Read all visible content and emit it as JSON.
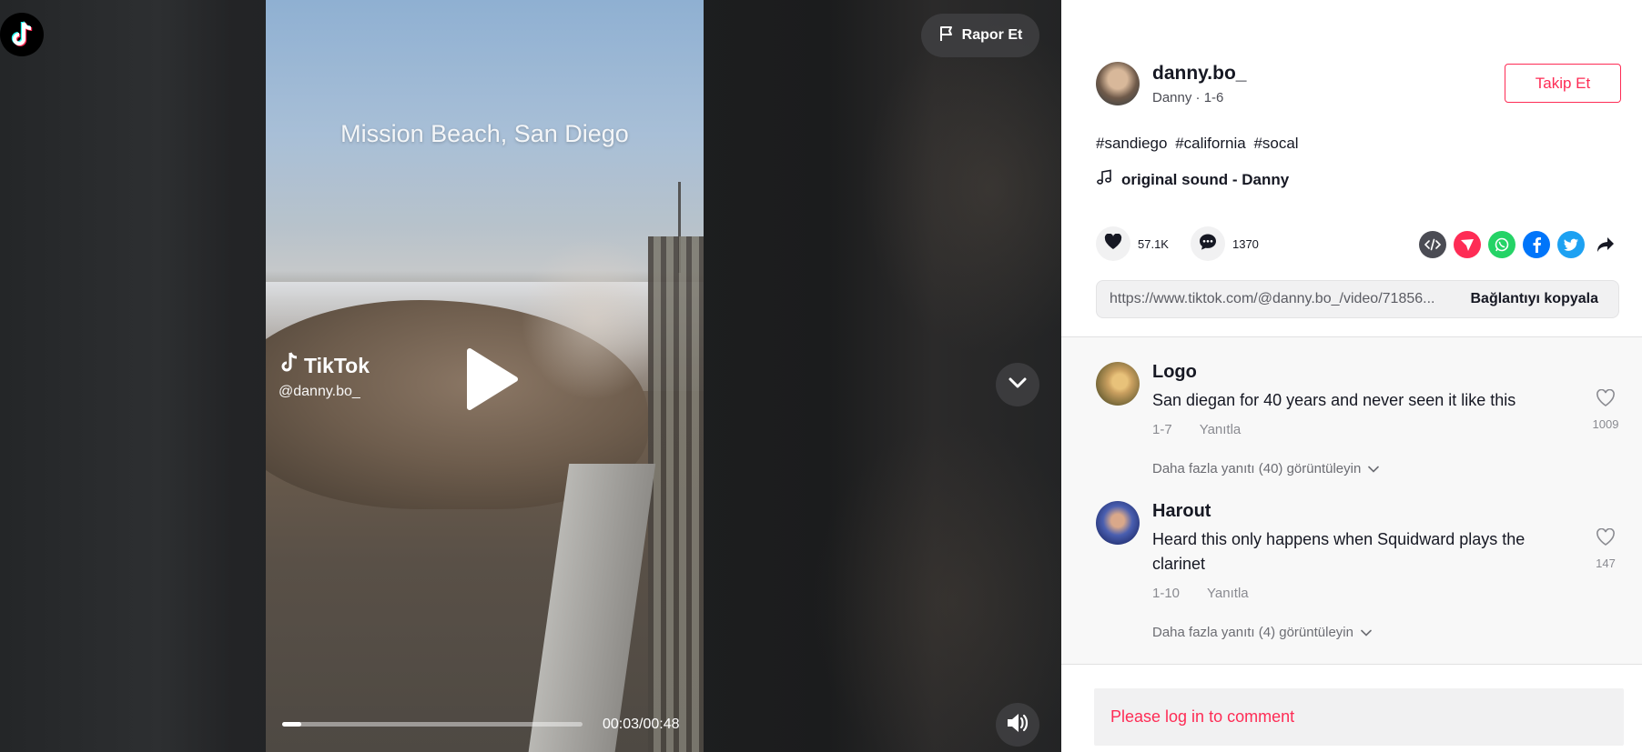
{
  "video": {
    "caption_overlay": "Mission Beach, San Diego",
    "watermark_brand": "TikTok",
    "watermark_user": "@danny.bo_",
    "time_display": "00:03/00:48",
    "progress": 0.0625,
    "report_label": "Rapor Et"
  },
  "author": {
    "username": "danny.bo_",
    "subtitle": "Danny · 1-6",
    "follow_label": "Takip Et"
  },
  "post": {
    "hashtags": [
      "#sandiego",
      "#california",
      "#socal"
    ],
    "sound": "original sound - Danny",
    "likes": "57.1K",
    "comments": "1370",
    "share_icons": [
      "embed-icon",
      "send-icon",
      "whatsapp-icon",
      "facebook-icon",
      "twitter-icon",
      "share-arrow-icon"
    ],
    "link_url": "https://www.tiktok.com/@danny.bo_/video/71856...",
    "copy_link_label": "Bağlantıyı kopyala"
  },
  "comments": [
    {
      "user": "Logo",
      "text": "San diegan for 40 years and never seen it like this",
      "date": "1-7",
      "reply_label": "Yanıtla",
      "likes": "1009",
      "more_replies": "Daha fazla yanıtı (40) görüntüleyin"
    },
    {
      "user": "Harout",
      "text": "Heard this only happens when Squidward plays the clarinet",
      "date": "1-10",
      "reply_label": "Yanıtla",
      "likes": "147",
      "more_replies": "Daha fazla yanıtı (4) görüntüleyin"
    }
  ],
  "login_prompt": "Please log in to comment",
  "colors": {
    "accent": "#fe2c55",
    "text_primary": "#161823",
    "whatsapp": "#25d366",
    "facebook": "#0075fa",
    "twitter": "#1da1f2",
    "send": "#fe2c55",
    "embed": "#4b4c54"
  }
}
